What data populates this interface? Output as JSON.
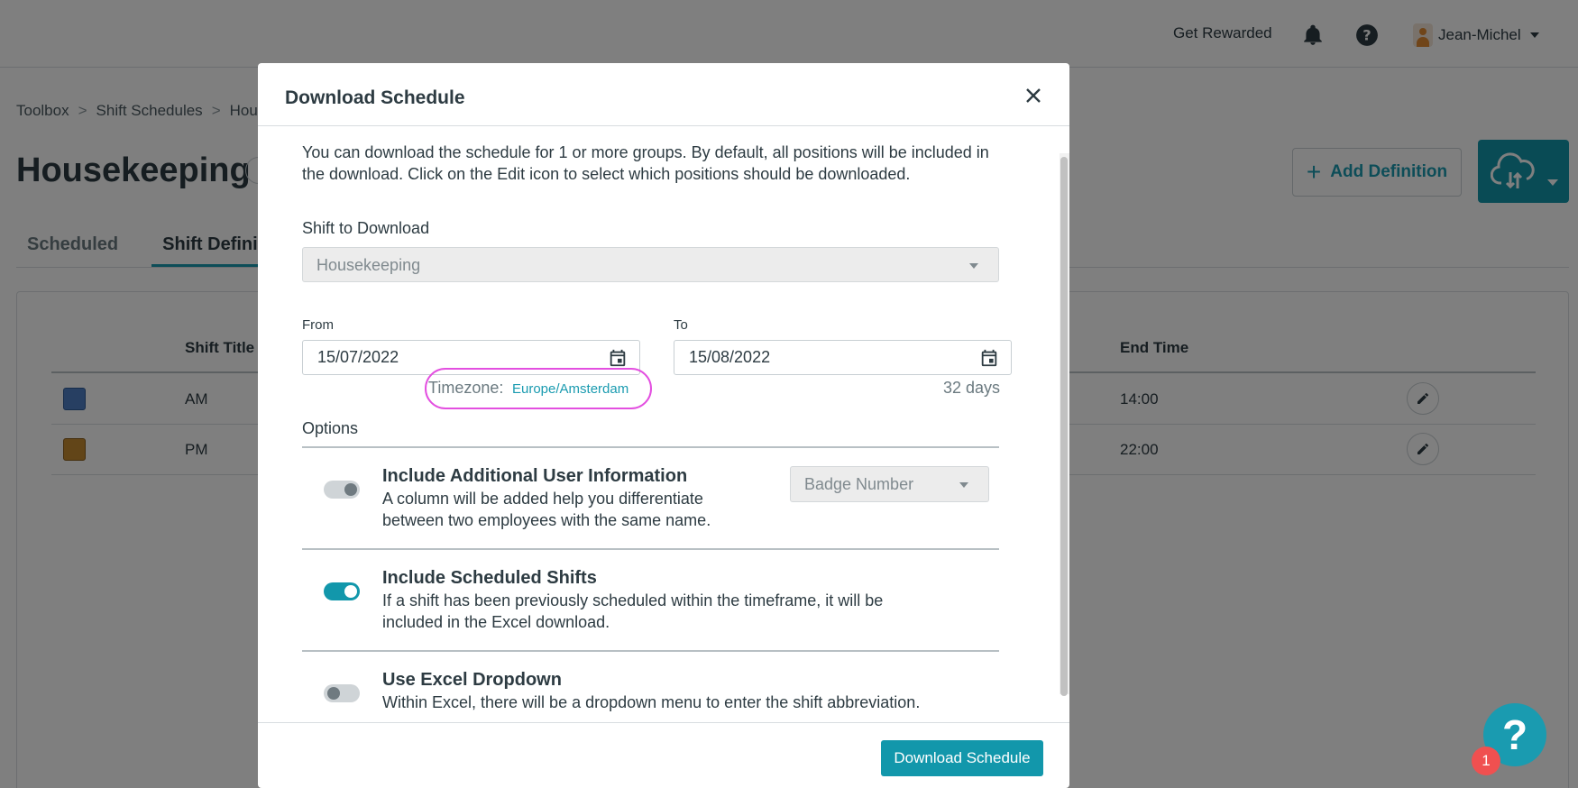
{
  "topbar": {
    "rewards_label": "Get Rewarded",
    "user_name": "Jean-Michel"
  },
  "breadcrumb": [
    "Toolbox",
    "Shift Schedules",
    "Hou"
  ],
  "breadcrumb_separator": ">",
  "page": {
    "title": "Housekeeping",
    "add_definition_label": "Add Definition",
    "tabs": [
      "Scheduled",
      "Shift Definitio"
    ]
  },
  "table": {
    "columns": [
      "Shift Title",
      "End Time"
    ],
    "rows": [
      {
        "color": "#4f7fc4",
        "title": "AM",
        "end": "14:00"
      },
      {
        "color": "#c58a30",
        "title": "PM",
        "end": "22:00"
      }
    ]
  },
  "modal": {
    "title": "Download Schedule",
    "intro": "You can download the schedule for 1 or more groups. By default, all positions will be included in the download. Click on the Edit icon to select which positions should be downloaded.",
    "shift_label": "Shift to Download",
    "shift_value": "Housekeeping",
    "from_label": "From",
    "from_value": "15/07/2022",
    "to_label": "To",
    "to_value": "15/08/2022",
    "timezone_label": "Timezone:",
    "timezone_value": "Europe/Amsterdam",
    "days": "32 days",
    "options_label": "Options",
    "options": [
      {
        "title": "Include Additional User Information",
        "desc": "A column will be added help you differentiate between two employees with the same name.",
        "enabled": false,
        "select_value": "Badge Number"
      },
      {
        "title": "Include Scheduled Shifts",
        "desc": "If a shift has been previously scheduled within the timeframe, it will be included in the Excel download.",
        "enabled": true
      },
      {
        "title": "Use Excel Dropdown",
        "desc": "Within Excel, there will be a dropdown menu to enter the shift abbreviation.",
        "enabled": false
      }
    ],
    "download_label": "Download Schedule"
  },
  "help": {
    "icon": "?",
    "count": "1"
  },
  "colors": {
    "accent": "#1297ab",
    "highlight": "#e34fe0",
    "badge": "#f05050"
  }
}
